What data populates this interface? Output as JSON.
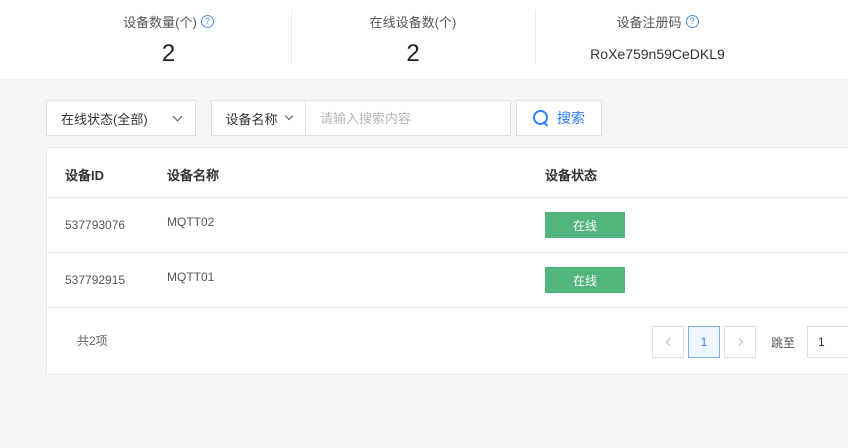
{
  "stats": {
    "device_count_label": "设备数量(个)",
    "device_count_value": "2",
    "online_count_label": "在线设备数(个)",
    "online_count_value": "2",
    "reg_code_label": "设备注册码",
    "reg_code_value": "RoXe759n59CeDKL9",
    "help_glyph": "?"
  },
  "filters": {
    "status_select": "在线状态(全部)",
    "field_select": "设备名称",
    "search_placeholder": "请输入搜索内容",
    "search_value": "",
    "search_button": "搜索"
  },
  "table": {
    "columns": [
      "设备ID",
      "设备名称",
      "设备状态"
    ],
    "rows": [
      {
        "id": "537793076",
        "name": "MQTT02",
        "status": "在线"
      },
      {
        "id": "537792915",
        "name": "MQTT01",
        "status": "在线"
      }
    ],
    "status_color": "#52b57e"
  },
  "pagination": {
    "total": "共2项",
    "current_page": "1",
    "jump_label": "跳至",
    "jump_value": "1"
  }
}
